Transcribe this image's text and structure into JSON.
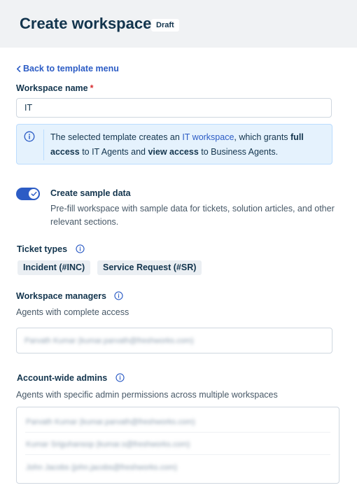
{
  "header": {
    "title": "Create workspace",
    "badge": "Draft"
  },
  "back_link": "Back to template menu",
  "workspace_name": {
    "label": "Workspace name",
    "required_mark": "*",
    "value": "IT"
  },
  "info": {
    "text_1": "The selected template creates an ",
    "link": "IT workspace",
    "text_2": ", which grants ",
    "bold_1": "full access",
    "text_3": " to IT Agents and ",
    "bold_2": "view access",
    "text_4": " to Business Agents."
  },
  "sample_data": {
    "enabled": true,
    "title": "Create sample data",
    "description": "Pre-fill workspace with sample data for tickets, solution articles, and other relevant sections."
  },
  "ticket_types": {
    "label": "Ticket types",
    "items": [
      "Incident (#INC)",
      "Service Request (#SR)"
    ]
  },
  "workspace_managers": {
    "label": "Workspace managers",
    "description": "Agents with complete access",
    "values": [
      "Parvath Kumar (kumar.parvath@freshworks.com)"
    ]
  },
  "account_admins": {
    "label": "Account-wide admins",
    "description": "Agents with specific admin permissions across multiple workspaces",
    "values": [
      "Parvath Kumar (kumar.parvath@freshworks.com)",
      "Kumar Sriguhansop (kumar.s@freshworks.com)",
      "John Jacobs (john.jacobs@freshworks.com)"
    ]
  },
  "colors": {
    "accent": "#2c5cc5",
    "header_bg": "#f0f2f4",
    "info_bg": "#e5f2fd",
    "required": "#d72d30"
  },
  "icons": [
    "chevron-left-icon",
    "info-icon",
    "check-icon"
  ]
}
